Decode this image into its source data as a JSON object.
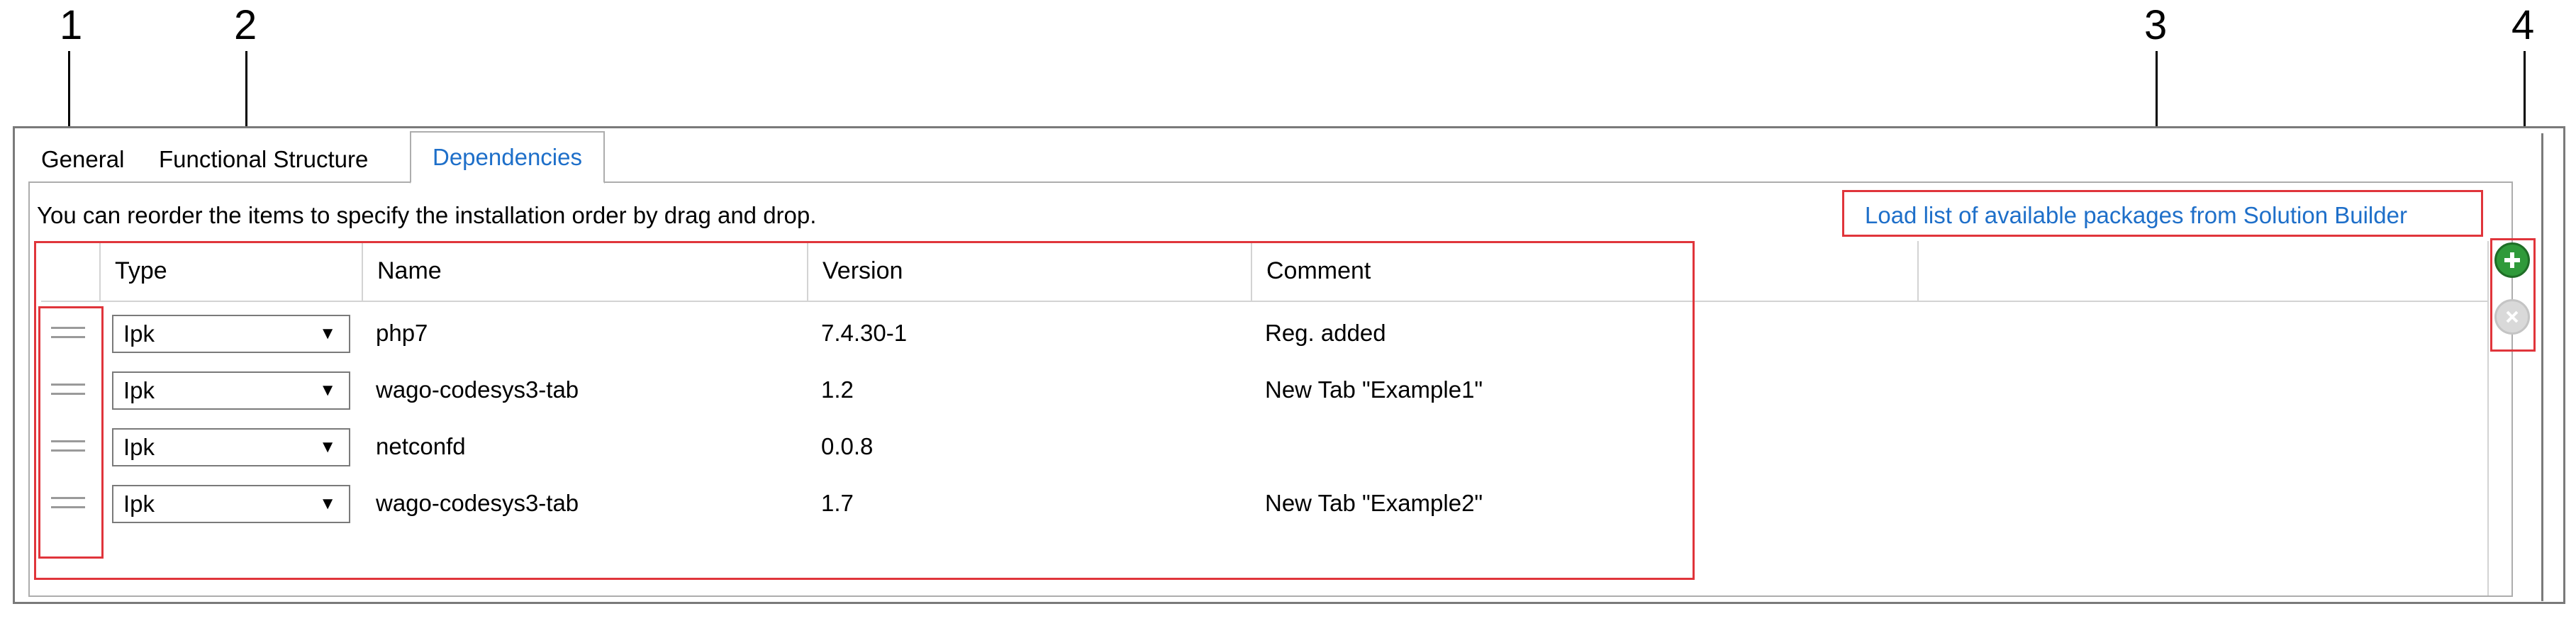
{
  "callouts": [
    "1",
    "2",
    "3",
    "4"
  ],
  "tabs": [
    {
      "label": "General",
      "active": false
    },
    {
      "label": "Functional Structure",
      "active": false
    },
    {
      "label": "Dependencies",
      "active": true
    }
  ],
  "hint": "You can reorder the items to specify the installation order by drag and drop.",
  "load_link": "Load list of available packages from Solution Builder",
  "columns": [
    "Type",
    "Name",
    "Version",
    "Comment"
  ],
  "rows": [
    {
      "type": "Ipk",
      "name": "php7",
      "version": "7.4.30-1",
      "comment": "Reg. added"
    },
    {
      "type": "Ipk",
      "name": "wago-codesys3-tab",
      "version": "1.2",
      "comment": "New Tab \"Example1\""
    },
    {
      "type": "Ipk",
      "name": "netconfd",
      "version": "0.0.8",
      "comment": ""
    },
    {
      "type": "Ipk",
      "name": "wago-codesys3-tab",
      "version": "1.7",
      "comment": "New Tab \"Example2\""
    }
  ],
  "icons": {
    "add": "plus-circle-icon",
    "remove": "x-circle-icon",
    "dropdown": "caret-down-icon",
    "drag": "drag-handle-icon"
  },
  "colors": {
    "link": "#1e6fc9",
    "callout_box": "#e0353b",
    "add_button": "#2f9a3a",
    "remove_button": "#d9d9d9"
  }
}
